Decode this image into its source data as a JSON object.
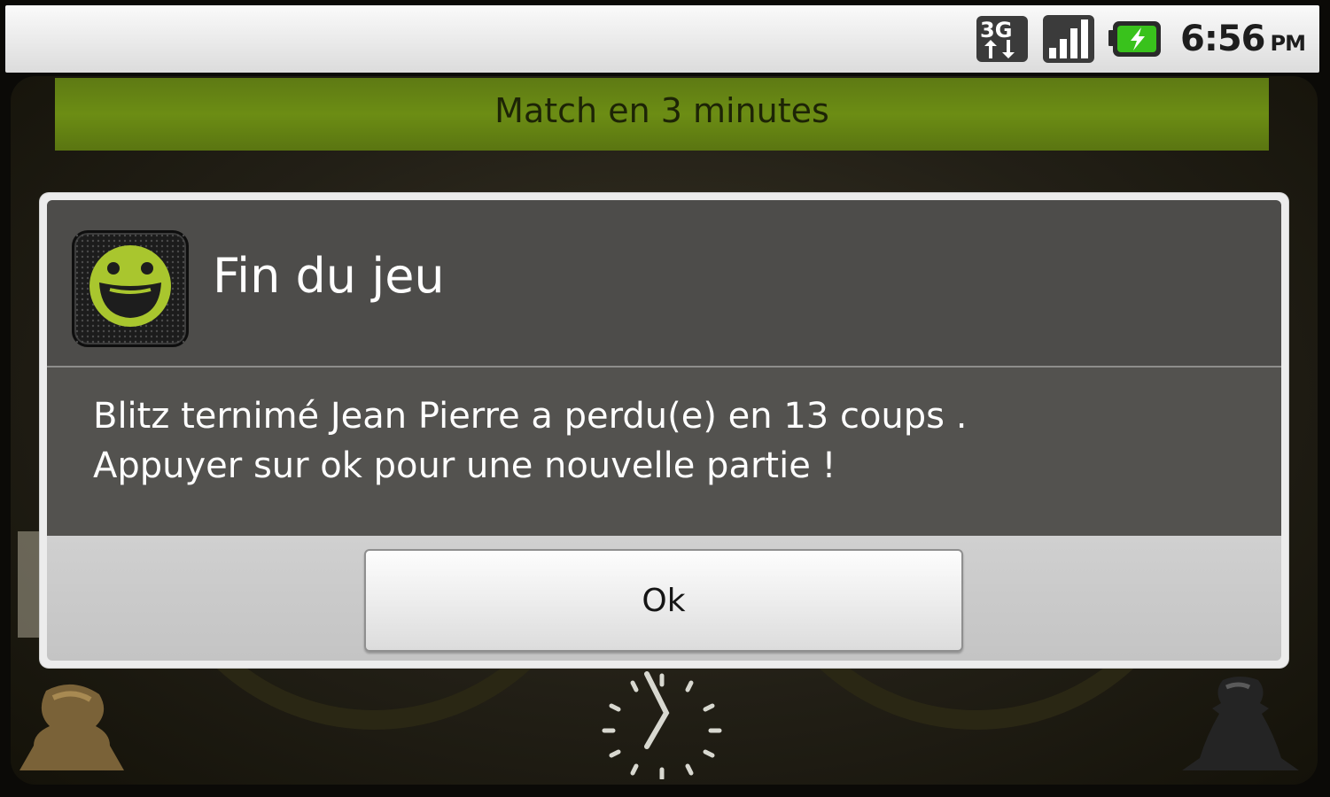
{
  "status_bar": {
    "network_type": "3G",
    "time": "6:56",
    "am_pm": "PM",
    "icons": [
      "3g-data-icon",
      "signal-strength-icon",
      "battery-charging-icon"
    ]
  },
  "app": {
    "header_title": "Match en 3 minutes",
    "colors": {
      "banner": "#6c8d14",
      "background": "#221f16"
    }
  },
  "dialog": {
    "title": "Fin du jeu",
    "icon": "smiley-app-icon",
    "message_lines": [
      "Blitz ternimé Jean Pierre a perdu(e) en 13 coups .",
      "Appuyer sur ok pour une nouvelle partie !"
    ],
    "ok_label": "Ok",
    "colors": {
      "title_bg": "#464543",
      "button_area_bg": "#c8c8c8",
      "icon_accent": "#a9c62e"
    }
  }
}
